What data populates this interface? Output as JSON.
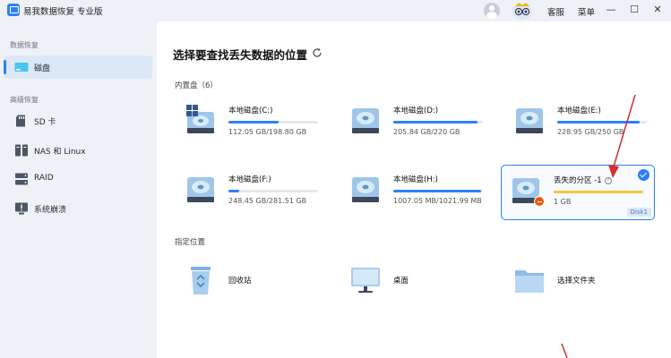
{
  "app": {
    "title": "易我数据恢复 专业版"
  },
  "titlebar": {
    "customer_service": "客服",
    "menu": "菜单",
    "minimize": "—",
    "maximize": "☐",
    "close": "✕"
  },
  "sidebar": {
    "section_data_recovery": "数据恢复",
    "section_advanced": "高级恢复",
    "items": [
      {
        "label": "磁盘",
        "icon": "disk-icon",
        "active": true
      },
      {
        "label": "SD 卡",
        "icon": "sd-card-icon"
      },
      {
        "label": "NAS 和 Linux",
        "icon": "nas-icon"
      },
      {
        "label": "RAID",
        "icon": "raid-icon"
      },
      {
        "label": "系统崩溃",
        "icon": "system-crash-icon"
      }
    ]
  },
  "main": {
    "title": "选择要查找丢失数据的位置",
    "internal_disks_label": "内置盘（6）",
    "specified_locations_label": "指定位置",
    "disks": [
      {
        "name": "本地磁盘(C:)",
        "size": "112.05 GB/198.80 GB",
        "used_fraction": 0.56,
        "icon": "windows-drive-icon"
      },
      {
        "name": "本地磁盘(D:)",
        "size": "205.84 GB/220 GB",
        "used_fraction": 0.94,
        "icon": "hard-drive-icon"
      },
      {
        "name": "本地磁盘(E:)",
        "size": "228.95 GB/250 GB",
        "used_fraction": 0.92,
        "icon": "hard-drive-icon"
      },
      {
        "name": "本地磁盘(F:)",
        "size": "248.45 GB/281.51 GB",
        "used_fraction": 0.12,
        "icon": "hard-drive-icon"
      },
      {
        "name": "本地磁盘(H:)",
        "size": "1007.05 MB/1021.99 MB",
        "used_fraction": 0.98,
        "icon": "hard-drive-icon"
      },
      {
        "name": "丢失的分区 -1",
        "size": "1 GB",
        "used_fraction": 1.0,
        "icon": "lost-partition-icon",
        "tag": "Disk1",
        "selected": true
      }
    ],
    "locations": [
      {
        "label": "回收站",
        "icon": "recycle-bin-icon"
      },
      {
        "label": "桌面",
        "icon": "desktop-icon"
      },
      {
        "label": "选择文件夹",
        "icon": "folder-icon"
      }
    ]
  },
  "colors": {
    "accent": "#2d7ff9",
    "lost_fill": "#f5c542",
    "lost_badge": "#e8590c",
    "annotation_arrow": "#d32f2f"
  }
}
